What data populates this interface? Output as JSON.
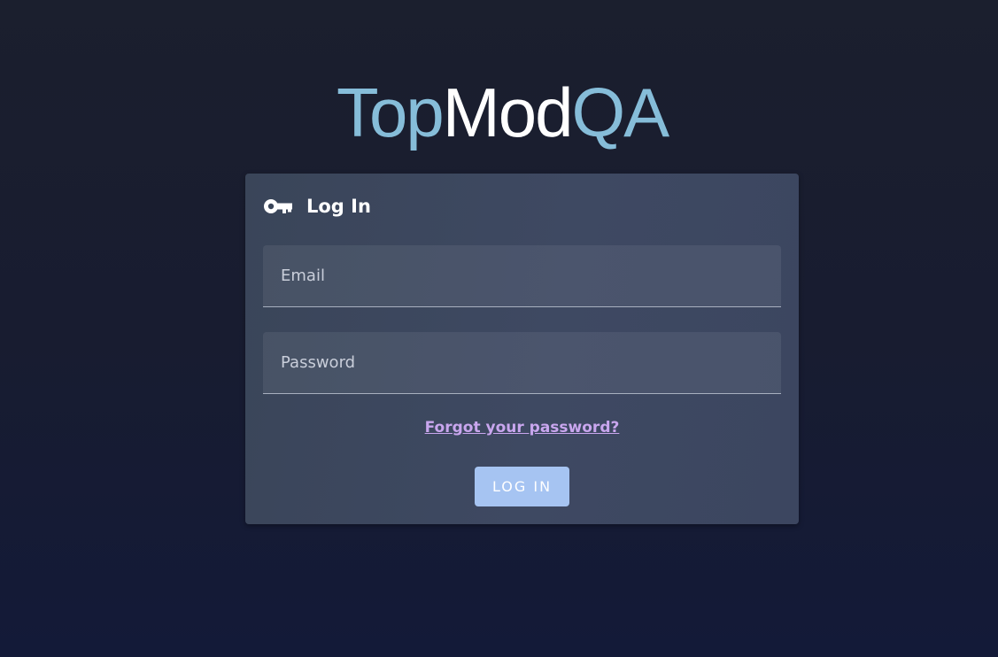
{
  "logo": {
    "part_a": "Top",
    "part_b": "Mod",
    "part_c": "QA",
    "colors": {
      "accent": "#86bdd9",
      "white": "#ffffff"
    }
  },
  "login_card": {
    "icon": "key-icon",
    "title": "Log In",
    "email": {
      "placeholder": "Email",
      "value": ""
    },
    "password": {
      "placeholder": "Password",
      "value": ""
    },
    "forgot_link": "Forgot your password?",
    "submit_label": "LOG IN"
  },
  "colors": {
    "background": "#181c30",
    "card": "#3c475e",
    "link": "#c9a6ee",
    "button": "#a6c4f2"
  }
}
